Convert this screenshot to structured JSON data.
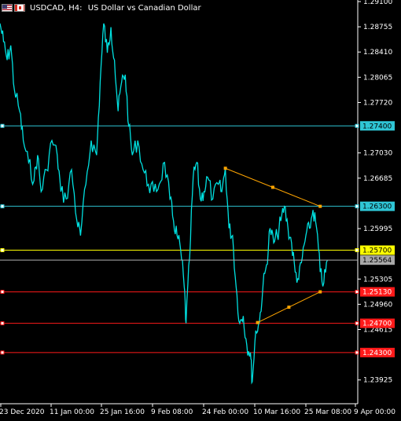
{
  "window": {
    "symbol": "USDCAD, H4:",
    "description": "US Dollar vs Canadian Dollar"
  },
  "icons": {
    "left_flag": "us-flag-icon",
    "right_flag": "canada-flag-icon"
  },
  "colors": {
    "background": "#000000",
    "price_line": "#00e0e0",
    "axis_text": "#ffffff",
    "level_cyan": "#2fc6d6",
    "level_yellow": "#ffff00",
    "level_red": "#ff1a1a",
    "trend": "#ffa500",
    "bid_line": "#b0b0b0"
  },
  "chart_data": {
    "type": "line",
    "price_axis": {
      "ticks": [
        "1.29100",
        "1.28755",
        "1.28410",
        "1.28065",
        "1.27720",
        "1.27030",
        "1.26685",
        "1.25995",
        "1.25305",
        "1.24960",
        "1.24615",
        "1.23925"
      ],
      "range": [
        1.236,
        1.291
      ]
    },
    "time_axis": {
      "ticks": [
        "23 Dec 2020",
        "11 Jan 00:00",
        "25 Jan 16:00",
        "9 Feb 08:00",
        "24 Feb 00:00",
        "10 Mar 16:00",
        "25 Mar 08:00",
        "9 Apr 00:00"
      ]
    },
    "levels": [
      {
        "price": 1.274,
        "label": "1.27400",
        "color": "#2fc6d6",
        "text_color": "#000000"
      },
      {
        "price": 1.263,
        "label": "1.26300",
        "color": "#2fc6d6",
        "text_color": "#000000"
      },
      {
        "price": 1.257,
        "label": "1.25700",
        "color": "#ffff00",
        "text_color": "#000000"
      },
      {
        "price": 1.2513,
        "label": "1.25130",
        "color": "#ff1a1a",
        "text_color": "#ffffff"
      },
      {
        "price": 1.247,
        "label": "1.24700",
        "color": "#ff1a1a",
        "text_color": "#ffffff"
      },
      {
        "price": 1.243,
        "label": "1.24300",
        "color": "#ff1a1a",
        "text_color": "#ffffff"
      }
    ],
    "current_price": {
      "price": 1.25564,
      "label": "1.25564"
    },
    "trendlines": [
      {
        "points": [
          [
            0.63,
            1.2682
          ],
          [
            0.895,
            1.263
          ]
        ]
      },
      {
        "points": [
          [
            0.72,
            1.2471
          ],
          [
            0.895,
            1.2513
          ]
        ]
      }
    ],
    "series_points": [
      [
        0.0,
        1.288
      ],
      [
        0.01,
        1.2855
      ],
      [
        0.02,
        1.283
      ],
      [
        0.03,
        1.285
      ],
      [
        0.04,
        1.279
      ],
      [
        0.055,
        1.276
      ],
      [
        0.065,
        1.272
      ],
      [
        0.08,
        1.269
      ],
      [
        0.095,
        1.2665
      ],
      [
        0.105,
        1.27
      ],
      [
        0.115,
        1.265
      ],
      [
        0.13,
        1.268
      ],
      [
        0.145,
        1.272
      ],
      [
        0.16,
        1.27
      ],
      [
        0.17,
        1.265
      ],
      [
        0.185,
        1.264
      ],
      [
        0.2,
        1.268
      ],
      [
        0.215,
        1.261
      ],
      [
        0.225,
        1.259
      ],
      [
        0.24,
        1.266
      ],
      [
        0.255,
        1.272
      ],
      [
        0.27,
        1.27
      ],
      [
        0.28,
        1.28
      ],
      [
        0.29,
        1.288
      ],
      [
        0.3,
        1.284
      ],
      [
        0.31,
        1.2875
      ],
      [
        0.32,
        1.283
      ],
      [
        0.33,
        1.276
      ],
      [
        0.34,
        1.28
      ],
      [
        0.35,
        1.281
      ],
      [
        0.36,
        1.274
      ],
      [
        0.37,
        1.27
      ],
      [
        0.385,
        1.272
      ],
      [
        0.4,
        1.268
      ],
      [
        0.415,
        1.266
      ],
      [
        0.43,
        1.265
      ],
      [
        0.445,
        1.266
      ],
      [
        0.46,
        1.269
      ],
      [
        0.475,
        1.264
      ],
      [
        0.485,
        1.261
      ],
      [
        0.495,
        1.259
      ],
      [
        0.505,
        1.257
      ],
      [
        0.515,
        1.252
      ],
      [
        0.52,
        1.247
      ],
      [
        0.53,
        1.256
      ],
      [
        0.54,
        1.267
      ],
      [
        0.55,
        1.269
      ],
      [
        0.56,
        1.264
      ],
      [
        0.57,
        1.265
      ],
      [
        0.58,
        1.267
      ],
      [
        0.595,
        1.264
      ],
      [
        0.61,
        1.266
      ],
      [
        0.62,
        1.265
      ],
      [
        0.63,
        1.2682
      ],
      [
        0.64,
        1.26
      ],
      [
        0.65,
        1.259
      ],
      [
        0.66,
        1.252
      ],
      [
        0.67,
        1.247
      ],
      [
        0.68,
        1.248
      ],
      [
        0.69,
        1.244
      ],
      [
        0.7,
        1.243
      ],
      [
        0.705,
        1.239
      ],
      [
        0.715,
        1.246
      ],
      [
        0.725,
        1.2471
      ],
      [
        0.735,
        1.252
      ],
      [
        0.745,
        1.255
      ],
      [
        0.755,
        1.26
      ],
      [
        0.765,
        1.258
      ],
      [
        0.775,
        1.259
      ],
      [
        0.785,
        1.261
      ],
      [
        0.795,
        1.263
      ],
      [
        0.805,
        1.26
      ],
      [
        0.815,
        1.258
      ],
      [
        0.825,
        1.254
      ],
      [
        0.835,
        1.253
      ],
      [
        0.845,
        1.256
      ],
      [
        0.855,
        1.259
      ],
      [
        0.865,
        1.26
      ],
      [
        0.875,
        1.2625
      ],
      [
        0.885,
        1.26
      ],
      [
        0.895,
        1.254
      ],
      [
        0.905,
        1.2525
      ],
      [
        0.915,
        1.2556
      ]
    ]
  }
}
